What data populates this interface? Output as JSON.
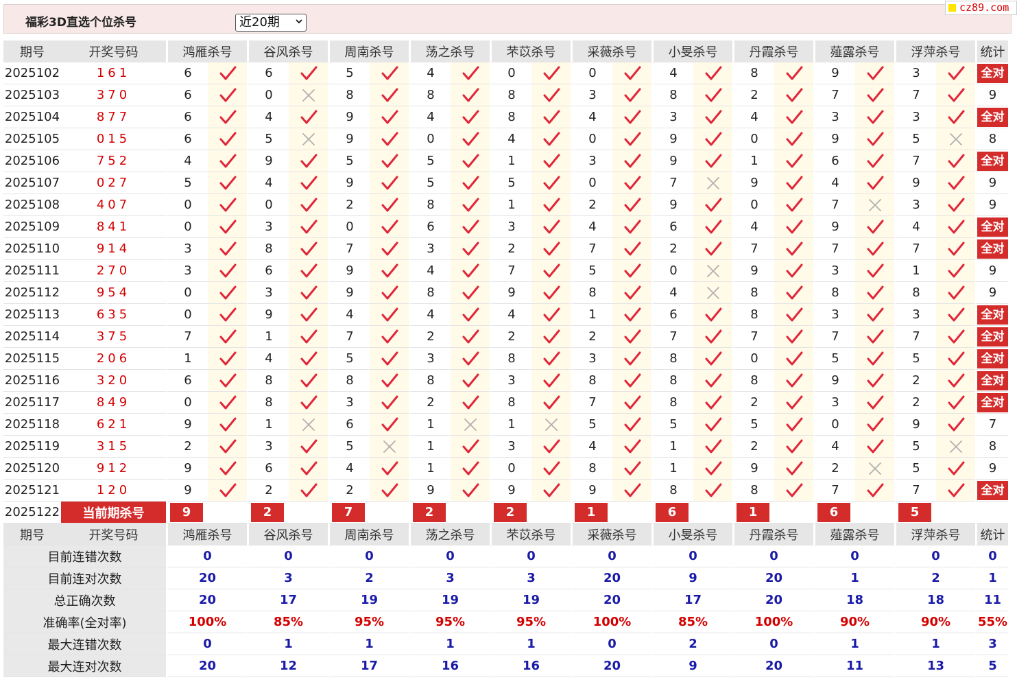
{
  "title": "福彩3D直选个位杀号",
  "period_select": "近20期",
  "logo": "cz89.com",
  "headers": [
    "期号",
    "开奖号码",
    "鸿雁杀号",
    "谷风杀号",
    "周南杀号",
    "荡之杀号",
    "芣苡杀号",
    "采薇杀号",
    "小旻杀号",
    "丹霞杀号",
    "薤露杀号",
    "浮萍杀号",
    "统计"
  ],
  "all_correct_label": "全对",
  "current_label": "当前期杀号",
  "rows": [
    {
      "id": "2025102",
      "draw": "161",
      "kills": [
        6,
        6,
        5,
        4,
        0,
        0,
        4,
        8,
        9,
        3
      ],
      "hits": [
        1,
        1,
        1,
        1,
        1,
        1,
        1,
        1,
        1,
        1
      ],
      "stat": "全对"
    },
    {
      "id": "2025103",
      "draw": "370",
      "kills": [
        6,
        0,
        8,
        8,
        8,
        3,
        8,
        2,
        7,
        7
      ],
      "hits": [
        1,
        0,
        1,
        1,
        1,
        1,
        1,
        1,
        1,
        1
      ],
      "stat": "9"
    },
    {
      "id": "2025104",
      "draw": "877",
      "kills": [
        6,
        4,
        9,
        4,
        8,
        4,
        3,
        4,
        3,
        3
      ],
      "hits": [
        1,
        1,
        1,
        1,
        1,
        1,
        1,
        1,
        1,
        1
      ],
      "stat": "全对"
    },
    {
      "id": "2025105",
      "draw": "015",
      "kills": [
        6,
        5,
        9,
        0,
        4,
        0,
        9,
        0,
        9,
        5
      ],
      "hits": [
        1,
        0,
        1,
        1,
        1,
        1,
        1,
        1,
        1,
        0
      ],
      "stat": "8"
    },
    {
      "id": "2025106",
      "draw": "752",
      "kills": [
        4,
        9,
        5,
        5,
        1,
        3,
        9,
        1,
        6,
        7
      ],
      "hits": [
        1,
        1,
        1,
        1,
        1,
        1,
        1,
        1,
        1,
        1
      ],
      "stat": "全对"
    },
    {
      "id": "2025107",
      "draw": "027",
      "kills": [
        5,
        4,
        9,
        5,
        5,
        0,
        7,
        9,
        4,
        9
      ],
      "hits": [
        1,
        1,
        1,
        1,
        1,
        1,
        0,
        1,
        1,
        1
      ],
      "stat": "9"
    },
    {
      "id": "2025108",
      "draw": "407",
      "kills": [
        0,
        0,
        2,
        8,
        1,
        2,
        9,
        0,
        7,
        3
      ],
      "hits": [
        1,
        1,
        1,
        1,
        1,
        1,
        1,
        1,
        0,
        1
      ],
      "stat": "9"
    },
    {
      "id": "2025109",
      "draw": "841",
      "kills": [
        0,
        3,
        0,
        6,
        3,
        4,
        6,
        4,
        9,
        4
      ],
      "hits": [
        1,
        1,
        1,
        1,
        1,
        1,
        1,
        1,
        1,
        1
      ],
      "stat": "全对"
    },
    {
      "id": "2025110",
      "draw": "914",
      "kills": [
        3,
        8,
        7,
        3,
        2,
        7,
        2,
        7,
        7,
        7
      ],
      "hits": [
        1,
        1,
        1,
        1,
        1,
        1,
        1,
        1,
        1,
        1
      ],
      "stat": "全对"
    },
    {
      "id": "2025111",
      "draw": "270",
      "kills": [
        3,
        6,
        9,
        4,
        7,
        5,
        0,
        9,
        3,
        1
      ],
      "hits": [
        1,
        1,
        1,
        1,
        1,
        1,
        0,
        1,
        1,
        1
      ],
      "stat": "9"
    },
    {
      "id": "2025112",
      "draw": "954",
      "kills": [
        0,
        3,
        9,
        8,
        9,
        8,
        4,
        8,
        8,
        8
      ],
      "hits": [
        1,
        1,
        1,
        1,
        1,
        1,
        0,
        1,
        1,
        1
      ],
      "stat": "9"
    },
    {
      "id": "2025113",
      "draw": "635",
      "kills": [
        0,
        9,
        4,
        4,
        4,
        1,
        6,
        8,
        3,
        3
      ],
      "hits": [
        1,
        1,
        1,
        1,
        1,
        1,
        1,
        1,
        1,
        1
      ],
      "stat": "全对"
    },
    {
      "id": "2025114",
      "draw": "375",
      "kills": [
        7,
        1,
        7,
        2,
        2,
        2,
        7,
        7,
        7,
        7
      ],
      "hits": [
        1,
        1,
        1,
        1,
        1,
        1,
        1,
        1,
        1,
        1
      ],
      "stat": "全对"
    },
    {
      "id": "2025115",
      "draw": "206",
      "kills": [
        1,
        4,
        5,
        3,
        8,
        3,
        8,
        0,
        5,
        5
      ],
      "hits": [
        1,
        1,
        1,
        1,
        1,
        1,
        1,
        1,
        1,
        1
      ],
      "stat": "全对"
    },
    {
      "id": "2025116",
      "draw": "320",
      "kills": [
        6,
        8,
        8,
        8,
        3,
        8,
        8,
        8,
        9,
        2
      ],
      "hits": [
        1,
        1,
        1,
        1,
        1,
        1,
        1,
        1,
        1,
        1
      ],
      "stat": "全对"
    },
    {
      "id": "2025117",
      "draw": "849",
      "kills": [
        0,
        8,
        3,
        2,
        8,
        7,
        8,
        2,
        3,
        2
      ],
      "hits": [
        1,
        1,
        1,
        1,
        1,
        1,
        1,
        1,
        1,
        1
      ],
      "stat": "全对"
    },
    {
      "id": "2025118",
      "draw": "621",
      "kills": [
        9,
        1,
        6,
        1,
        1,
        5,
        5,
        5,
        0,
        9
      ],
      "hits": [
        1,
        0,
        1,
        0,
        0,
        1,
        1,
        1,
        1,
        1
      ],
      "stat": "7"
    },
    {
      "id": "2025119",
      "draw": "315",
      "kills": [
        2,
        3,
        5,
        1,
        3,
        4,
        1,
        2,
        4,
        5
      ],
      "hits": [
        1,
        1,
        0,
        1,
        1,
        1,
        1,
        1,
        1,
        0
      ],
      "stat": "8"
    },
    {
      "id": "2025120",
      "draw": "912",
      "kills": [
        9,
        6,
        4,
        1,
        0,
        8,
        1,
        9,
        2,
        5
      ],
      "hits": [
        1,
        1,
        1,
        1,
        1,
        1,
        1,
        1,
        0,
        1
      ],
      "stat": "9"
    },
    {
      "id": "2025121",
      "draw": "120",
      "kills": [
        9,
        2,
        2,
        9,
        9,
        9,
        8,
        8,
        7,
        7
      ],
      "hits": [
        1,
        1,
        1,
        1,
        1,
        1,
        1,
        1,
        1,
        1
      ],
      "stat": "全对"
    }
  ],
  "current": {
    "id": "2025122",
    "kills": [
      9,
      2,
      7,
      2,
      2,
      1,
      6,
      1,
      6,
      5
    ]
  },
  "summary": [
    {
      "label": "目前连错次数",
      "color": "blue",
      "values": [
        "0",
        "0",
        "0",
        "0",
        "0",
        "0",
        "0",
        "0",
        "0",
        "0"
      ],
      "stat": "0"
    },
    {
      "label": "目前连对次数",
      "color": "blue",
      "values": [
        "20",
        "3",
        "2",
        "3",
        "3",
        "20",
        "9",
        "20",
        "1",
        "2"
      ],
      "stat": "1"
    },
    {
      "label": "总正确次数",
      "color": "blue",
      "values": [
        "20",
        "17",
        "19",
        "19",
        "19",
        "20",
        "17",
        "20",
        "18",
        "18"
      ],
      "stat": "11"
    },
    {
      "label": "准确率(全对率)",
      "color": "red",
      "values": [
        "100%",
        "85%",
        "95%",
        "95%",
        "95%",
        "100%",
        "85%",
        "100%",
        "90%",
        "90%"
      ],
      "stat": "55%"
    },
    {
      "label": "最大连错次数",
      "color": "blue",
      "values": [
        "0",
        "1",
        "1",
        "1",
        "1",
        "0",
        "2",
        "0",
        "1",
        "1"
      ],
      "stat": "3"
    },
    {
      "label": "最大连对次数",
      "color": "blue",
      "values": [
        "20",
        "12",
        "17",
        "16",
        "16",
        "20",
        "9",
        "20",
        "11",
        "13"
      ],
      "stat": "5"
    }
  ]
}
